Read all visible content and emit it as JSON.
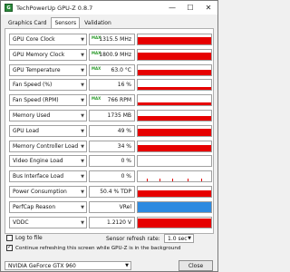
{
  "window": {
    "title": "TechPowerUp GPU-Z 0.8.7",
    "icon_name": "gpuz-app-icon",
    "controls": {
      "minimize": "—",
      "maximize": "☐",
      "close": "✕"
    }
  },
  "tabs": [
    {
      "label": "Graphics Card",
      "active": false
    },
    {
      "label": "Sensors",
      "active": true
    },
    {
      "label": "Validation",
      "active": false
    }
  ],
  "sensors": [
    {
      "label": "GPU Core Clock",
      "value": "1315.5 MHz",
      "max": "MAX",
      "graph": "bar",
      "fill": 0.72
    },
    {
      "label": "GPU Memory Clock",
      "value": "1800.9 MHz",
      "max": "MAX",
      "graph": "bar",
      "fill": 0.72
    },
    {
      "label": "GPU Temperature",
      "value": "63.0 °C",
      "max": "MAX",
      "graph": "bar",
      "fill": 0.55
    },
    {
      "label": "Fan Speed (%)",
      "value": "16 %",
      "max": "",
      "graph": "bar",
      "fill": 0.25
    },
    {
      "label": "Fan Speed (RPM)",
      "value": "766 RPM",
      "max": "MAX",
      "graph": "bar",
      "fill": 0.3
    },
    {
      "label": "Memory Used",
      "value": "1735 MB",
      "max": "",
      "graph": "bar",
      "fill": 0.45
    },
    {
      "label": "GPU Load",
      "value": "49 %",
      "max": "",
      "graph": "bar",
      "fill": 0.7
    },
    {
      "label": "Memory Controller Load",
      "value": "34 %",
      "max": "",
      "graph": "bar",
      "fill": 0.6
    },
    {
      "label": "Video Engine Load",
      "value": "0 %",
      "max": "",
      "graph": "empty",
      "fill": 0
    },
    {
      "label": "Bus Interface Load",
      "value": "0 %",
      "max": "",
      "graph": "spikes",
      "fill": 0.1
    },
    {
      "label": "Power Consumption",
      "value": "50.4 % TDP",
      "max": "",
      "graph": "bar",
      "fill": 0.62
    },
    {
      "label": "PerfCap Reason",
      "value": "VRel",
      "max": "",
      "graph": "blue",
      "fill": 1
    },
    {
      "label": "VDDC",
      "value": "1.2120 V",
      "max": "",
      "graph": "bar",
      "fill": 0.9
    }
  ],
  "options": {
    "log_to_file": {
      "label": "Log to file",
      "checked": false
    },
    "continue_refresh": {
      "label": "Continue refreshing this screen while GPU-Z is in the background",
      "checked": true
    },
    "refresh_rate": {
      "label": "Sensor refresh rate:",
      "value": "1.0 sec"
    }
  },
  "footer": {
    "gpu_select": "NVIDIA GeForce GTX 960",
    "close_label": "Close"
  },
  "colors": {
    "graph_red": "#e60000",
    "graph_blue": "#2d8ae0",
    "max_green": "#2a9a2a"
  }
}
